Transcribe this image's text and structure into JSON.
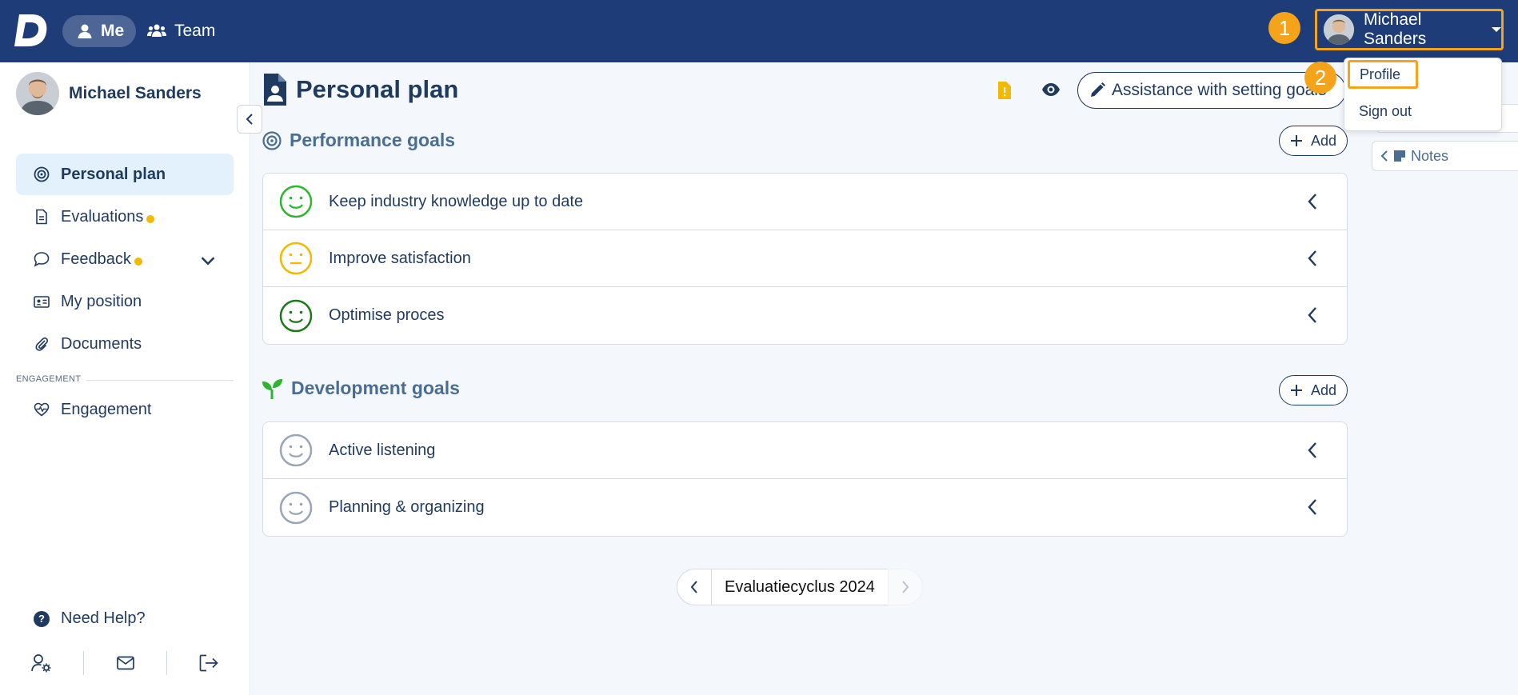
{
  "topbar": {
    "nav": [
      {
        "label": "Me",
        "icon": "user-icon",
        "active": true
      },
      {
        "label": "Team",
        "icon": "users-icon",
        "active": false
      }
    ],
    "user_name": "Michael Sanders",
    "menu": {
      "profile": "Profile",
      "sign_out": "Sign out"
    },
    "callouts": [
      "1",
      "2"
    ],
    "accent_color": "#f5a31a",
    "bar_color": "#1e3d78"
  },
  "sidebar": {
    "user_name": "Michael Sanders",
    "items": [
      {
        "label": "Personal plan",
        "icon": "target-icon",
        "active": true
      },
      {
        "label": "Evaluations",
        "icon": "document-icon",
        "dot": true
      },
      {
        "label": "Feedback",
        "icon": "chat-icon",
        "dot": true,
        "expandable": true
      },
      {
        "label": "My position",
        "icon": "id-card-icon"
      },
      {
        "label": "Documents",
        "icon": "paperclip-icon"
      }
    ],
    "section_label": "ENGAGEMENT",
    "engagement_item": {
      "label": "Engagement",
      "icon": "heart-pulse-icon"
    },
    "help_label": "Need Help?"
  },
  "main": {
    "title": "Personal plan",
    "assist_label": "Assistance with setting goals",
    "performance": {
      "title": "Performance goals",
      "add_label": "Add",
      "goals": [
        {
          "label": "Keep industry knowledge up to date",
          "mood": "happy",
          "color": "#2db52d"
        },
        {
          "label": "Improve satisfaction",
          "mood": "neutral",
          "color": "#f5b800"
        },
        {
          "label": "Optimise proces",
          "mood": "happy",
          "color": "#1a7a1a"
        }
      ]
    },
    "development": {
      "title": "Development goals",
      "add_label": "Add",
      "goals": [
        {
          "label": "Active listening",
          "mood": "happy",
          "color": "#9aa6b5"
        },
        {
          "label": "Planning & organizing",
          "mood": "happy",
          "color": "#9aa6b5"
        }
      ]
    },
    "cycle_label": "Evaluatiecyclus 2024",
    "notes_label": "Notes"
  }
}
